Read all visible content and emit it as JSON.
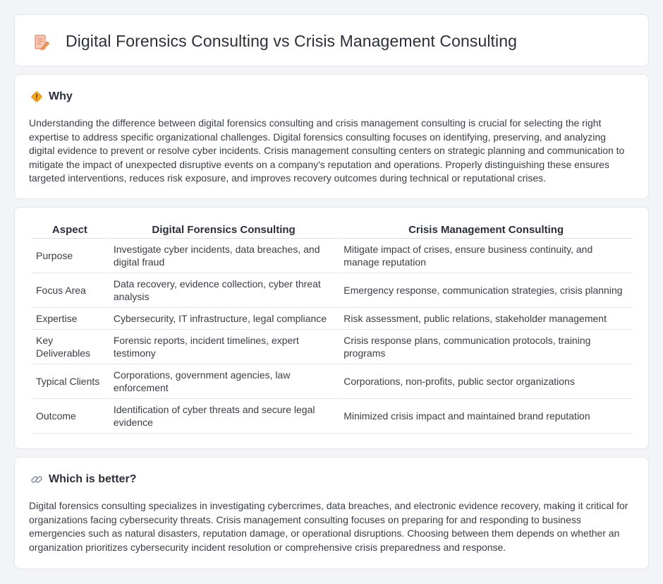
{
  "header": {
    "title": "Digital Forensics Consulting vs Crisis Management Consulting",
    "icon": "document-pencil-icon"
  },
  "why": {
    "heading": "Why",
    "icon": "warning-diamond-icon",
    "text": "Understanding the difference between digital forensics consulting and crisis management consulting is crucial for selecting the right expertise to address specific organizational challenges. Digital forensics consulting focuses on identifying, preserving, and analyzing digital evidence to prevent or resolve cyber incidents. Crisis management consulting centers on strategic planning and communication to mitigate the impact of unexpected disruptive events on a company's reputation and operations. Properly distinguishing these ensures targeted interventions, reduces risk exposure, and improves recovery outcomes during technical or reputational crises."
  },
  "table": {
    "headers": [
      "Aspect",
      "Digital Forensics Consulting",
      "Crisis Management Consulting"
    ],
    "rows": [
      [
        "Purpose",
        "Investigate cyber incidents, data breaches, and digital fraud",
        "Mitigate impact of crises, ensure business continuity, and manage reputation"
      ],
      [
        "Focus Area",
        "Data recovery, evidence collection, cyber threat analysis",
        "Emergency response, communication strategies, crisis planning"
      ],
      [
        "Expertise",
        "Cybersecurity, IT infrastructure, legal compliance",
        "Risk assessment, public relations, stakeholder management"
      ],
      [
        "Key Deliverables",
        "Forensic reports, incident timelines, expert testimony",
        "Crisis response plans, communication protocols, training programs"
      ],
      [
        "Typical Clients",
        "Corporations, government agencies, law enforcement",
        "Corporations, non-profits, public sector organizations"
      ],
      [
        "Outcome",
        "Identification of cyber threats and secure legal evidence",
        "Minimized crisis impact and maintained brand reputation"
      ]
    ]
  },
  "which": {
    "heading": "Which is better?",
    "icon": "link-icon",
    "text": "Digital forensics consulting specializes in investigating cybercrimes, data breaches, and electronic evidence recovery, making it critical for organizations facing cybersecurity threats. Crisis management consulting focuses on preparing for and responding to business emergencies such as natural disasters, reputation damage, or operational disruptions. Choosing between them depends on whether an organization prioritizes cybersecurity incident resolution or comprehensive crisis preparedness and response."
  }
}
